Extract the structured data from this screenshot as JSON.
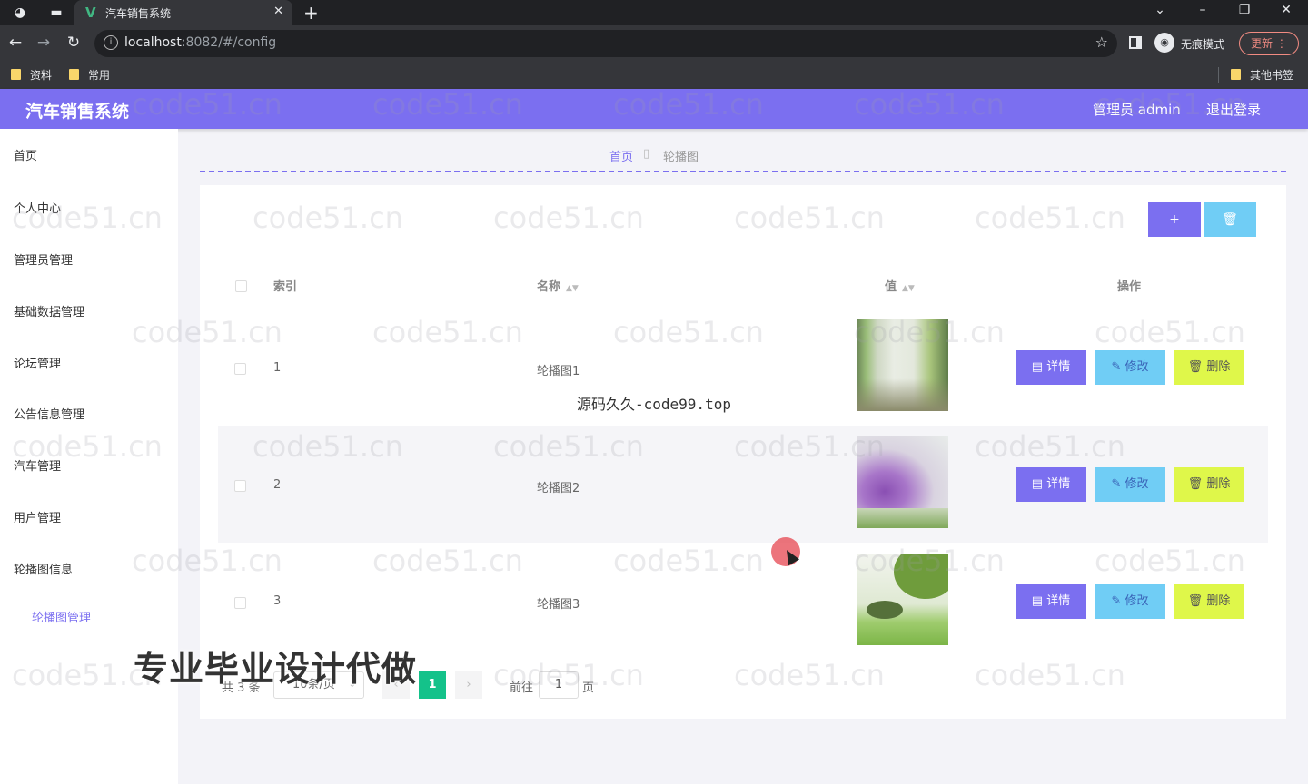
{
  "browser": {
    "tab_title": "汽车销售系统",
    "url_host": "localhost",
    "url_rest": ":8082/#/config",
    "incognito_label": "无痕模式",
    "update_label": "更新",
    "bookmarks": [
      {
        "label": "资料"
      },
      {
        "label": "常用"
      }
    ],
    "other_bookmarks": "其他书签"
  },
  "header": {
    "title": "汽车销售系统",
    "user": "管理员 admin",
    "logout": "退出登录"
  },
  "sidebar": {
    "items": [
      {
        "label": "首页"
      },
      {
        "label": "个人中心"
      },
      {
        "label": "管理员管理"
      },
      {
        "label": "基础数据管理"
      },
      {
        "label": "论坛管理"
      },
      {
        "label": "公告信息管理"
      },
      {
        "label": "汽车管理"
      },
      {
        "label": "用户管理"
      },
      {
        "label": "轮播图信息"
      }
    ],
    "sub_item": "轮播图管理"
  },
  "breadcrumb": {
    "home": "首页",
    "current": "轮播图"
  },
  "toolbar": {
    "add_icon": "+",
    "delete_icon": "🗑"
  },
  "table": {
    "columns": {
      "index": "索引",
      "name": "名称",
      "value": "值",
      "actions": "操作"
    },
    "rows": [
      {
        "index": "1",
        "name": "轮播图1",
        "image": "bamboo-image"
      },
      {
        "index": "2",
        "name": "轮播图2",
        "image": "purple-flowers-image"
      },
      {
        "index": "3",
        "name": "轮播图3",
        "image": "green-tree-image"
      }
    ],
    "actions": {
      "detail": "详情",
      "edit": "修改",
      "delete": "删除"
    }
  },
  "pagination": {
    "total": "共 3 条",
    "page_size": "10条/页",
    "current_page": "1",
    "goto_label": "前往",
    "goto_value": "1",
    "page_unit": "页"
  },
  "overlays": {
    "center_mark": "源码久久-code99.top",
    "promo": "专业毕业设计代做",
    "watermark": "code51.cn"
  },
  "colors": {
    "primary": "#7b6ff0",
    "info": "#70cdf5",
    "warning": "#dff74a",
    "success": "#14c28a"
  }
}
